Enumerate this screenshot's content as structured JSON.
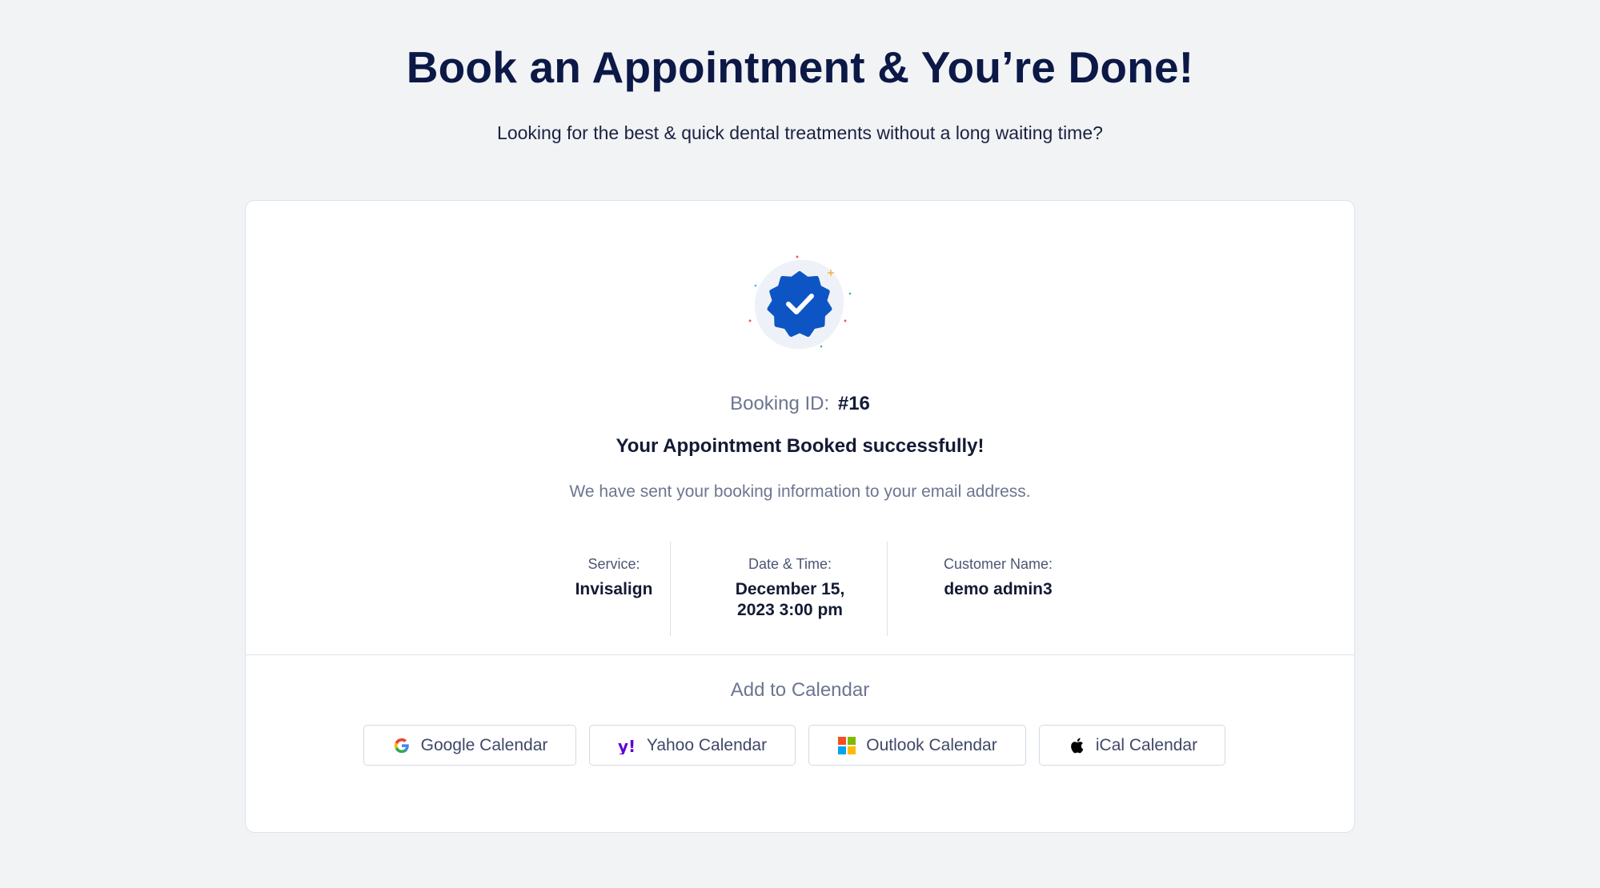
{
  "hero": {
    "title": "Book an Appointment & You’re Done!",
    "subtitle": "Looking for the best & quick dental treatments without a long waiting time?"
  },
  "booking": {
    "id_label": "Booking ID:",
    "id_value": "#16",
    "success_title": "Your Appointment Booked successfully!",
    "success_text": "We have sent your booking information to your email address."
  },
  "details": {
    "service_label": "Service:",
    "service_value": "Invisalign",
    "datetime_label": "Date & Time:",
    "datetime_line1": "December 15,",
    "datetime_line2": "2023 3:00 pm",
    "customer_label": "Customer Name:",
    "customer_value": "demo admin3"
  },
  "calendar": {
    "title": "Add to Calendar",
    "google": "Google Calendar",
    "yahoo": "Yahoo Calendar",
    "outlook": "Outlook Calendar",
    "ical": "iCal Calendar"
  },
  "colors": {
    "badge": "#0d55c4",
    "heading": "#0c1846",
    "muted": "#6d7690",
    "yahoo": "#6001d2"
  },
  "icons": [
    "verified-badge-icon",
    "google-icon",
    "yahoo-icon",
    "microsoft-icon",
    "apple-icon"
  ]
}
